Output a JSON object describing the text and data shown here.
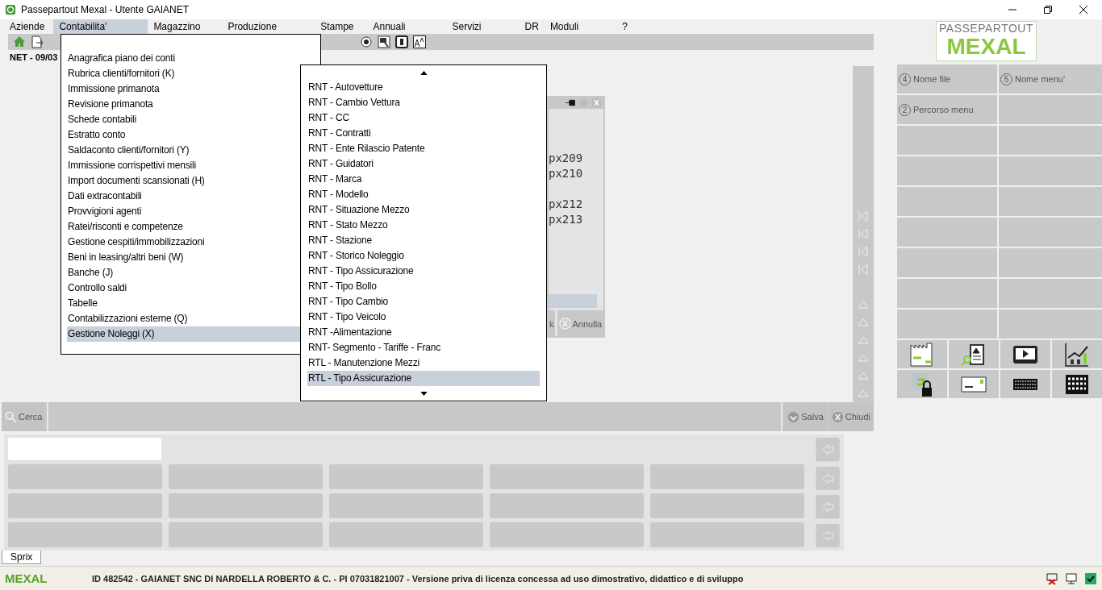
{
  "window": {
    "title": "Passepartout Mexal - Utente GAIANET"
  },
  "menu_bar": [
    {
      "label": "Aziende",
      "selected": false
    },
    {
      "label": "Contabilita'",
      "selected": true
    },
    {
      "label": "Magazzino",
      "selected": false
    },
    {
      "label": "Produzione",
      "selected": false
    },
    {
      "label": "Stampe",
      "selected": false
    },
    {
      "label": "Annuali",
      "selected": false
    },
    {
      "label": "Servizi",
      "selected": false
    },
    {
      "label": "DR",
      "selected": false
    },
    {
      "label": "Moduli",
      "selected": false
    },
    {
      "label": "?",
      "selected": false
    }
  ],
  "status_text": "NET - 09/03",
  "dropdown": {
    "items": [
      {
        "label": "Anagrafica piano dei conti",
        "selected": false
      },
      {
        "label": "Rubrica clienti/fornitori (K)",
        "selected": false
      },
      {
        "label": "Immissione primanota",
        "selected": false
      },
      {
        "label": "Revisione primanota",
        "selected": false
      },
      {
        "label": "Schede contabili",
        "selected": false
      },
      {
        "label": "Estratto conto",
        "selected": false
      },
      {
        "label": "Saldaconto clienti/fornitori (Y)",
        "selected": false
      },
      {
        "label": "Immissione corrispettivi mensili",
        "selected": false
      },
      {
        "label": "Import documenti scansionati (H)",
        "selected": false
      },
      {
        "label": "Dati extracontabili",
        "selected": false
      },
      {
        "label": "Provvigioni agenti",
        "selected": false
      },
      {
        "label": "Ratei/risconti e competenze",
        "selected": false
      },
      {
        "label": "Gestione cespiti/immobilizzazioni",
        "selected": false
      },
      {
        "label": "Beni in leasing/altri beni (W)",
        "selected": false
      },
      {
        "label": "Banche (J)",
        "selected": false
      },
      {
        "label": "Controllo saldi",
        "selected": false
      },
      {
        "label": "Tabelle",
        "selected": false
      },
      {
        "label": "Contabilizzazioni esterne (Q)",
        "selected": false
      },
      {
        "label": "Gestione Noleggi (X)",
        "selected": true
      }
    ]
  },
  "submenu": {
    "items": [
      {
        "label": "RNT - Autovetture",
        "selected": false
      },
      {
        "label": "RNT - Cambio Vettura",
        "selected": false
      },
      {
        "label": "RNT - CC",
        "selected": false
      },
      {
        "label": "RNT - Contratti",
        "selected": false
      },
      {
        "label": "RNT - Ente Rilascio Patente",
        "selected": false
      },
      {
        "label": "RNT - Guidatori",
        "selected": false
      },
      {
        "label": "RNT - Marca",
        "selected": false
      },
      {
        "label": "RNT - Modello",
        "selected": false
      },
      {
        "label": "RNT - Situazione Mezzo",
        "selected": false
      },
      {
        "label": "RNT - Stato Mezzo",
        "selected": false
      },
      {
        "label": "RNT - Stazione",
        "selected": false
      },
      {
        "label": "RNT - Storico Noleggio",
        "selected": false
      },
      {
        "label": "RNT - Tipo Assicurazione",
        "selected": false
      },
      {
        "label": "RNT - Tipo Bollo",
        "selected": false
      },
      {
        "label": "RNT - Tipo Cambio",
        "selected": false
      },
      {
        "label": "RNT - Tipo Veicolo",
        "selected": false
      },
      {
        "label": "RNT -Alimentazione",
        "selected": false
      },
      {
        "label": "RNT- Segmento - Tariffe - Franc",
        "selected": false
      },
      {
        "label": "RTL - Manutenzione Mezzi",
        "selected": false
      },
      {
        "label": "RTL - Tipo Assicurazione",
        "selected": true
      }
    ]
  },
  "background_dialog": {
    "groups": [
      [
        "px209",
        "px210"
      ],
      [
        "px212",
        "px213"
      ]
    ],
    "buttons": [
      "k",
      "Annulla"
    ]
  },
  "logo": {
    "top": "PASSEPARTOUT",
    "bottom": "MEXAL"
  },
  "info_cells": [
    {
      "number": "4",
      "label": "Nome file"
    },
    {
      "number": "5",
      "label": "Nome menu'"
    },
    {
      "number": "2",
      "label": "Percorso menu"
    }
  ],
  "search_bar": {
    "button": "Cerca",
    "actions": [
      "Salva",
      "Chiudi"
    ]
  },
  "tab": {
    "label": "Sprix"
  },
  "status_bar": {
    "logo": "MEXAL",
    "text": "ID 482542 - GAIANET SNC DI NARDELLA ROBERTO & C. - PI 07031821007 - Versione priva di licenza concessa ad uso dimostrativo, didattico e di sviluppo"
  }
}
